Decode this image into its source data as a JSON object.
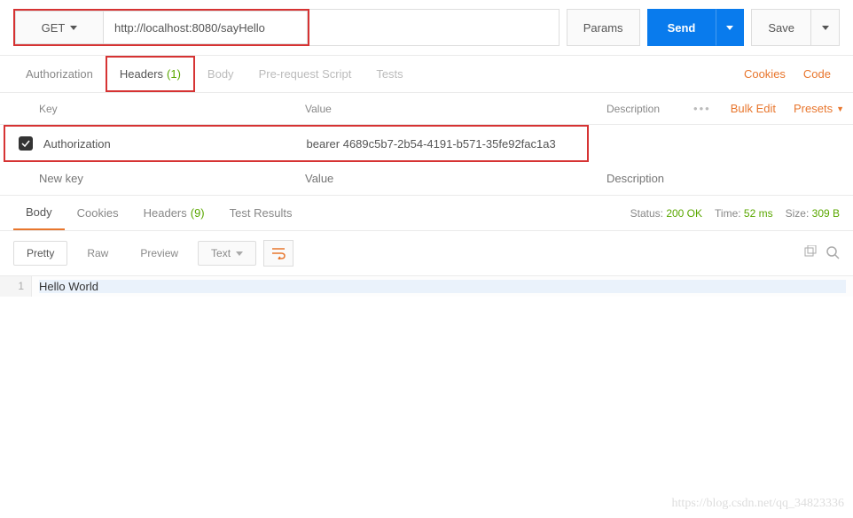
{
  "request": {
    "method": "GET",
    "url_highlighted": "http://localhost:8080/sayHello",
    "params_btn": "Params",
    "send_btn": "Send",
    "save_btn": "Save"
  },
  "tabs": {
    "authorization": "Authorization",
    "headers": "Headers",
    "headers_count": "(1)",
    "body": "Body",
    "prerequest": "Pre-request Script",
    "tests": "Tests",
    "cookies_link": "Cookies",
    "code_link": "Code"
  },
  "table": {
    "th_key": "Key",
    "th_value": "Value",
    "th_desc": "Description",
    "bulk_edit": "Bulk Edit",
    "presets": "Presets",
    "rows": [
      {
        "key": "Authorization",
        "value": "bearer 4689c5b7-2b54-4191-b571-35fe92fac1a3"
      }
    ],
    "placeholder_key": "New key",
    "placeholder_value": "Value",
    "placeholder_desc": "Description"
  },
  "response": {
    "tab_body": "Body",
    "tab_cookies": "Cookies",
    "tab_headers": "Headers",
    "tab_headers_count": "(9)",
    "tab_testresults": "Test Results",
    "status_label": "Status:",
    "status_value": "200 OK",
    "time_label": "Time:",
    "time_value": "52 ms",
    "size_label": "Size:",
    "size_value": "309 B"
  },
  "body_toolbar": {
    "pretty": "Pretty",
    "raw": "Raw",
    "preview": "Preview",
    "format": "Text"
  },
  "code": {
    "line_no": "1",
    "content": "Hello World"
  },
  "watermark": "https://blog.csdn.net/qq_34823336"
}
